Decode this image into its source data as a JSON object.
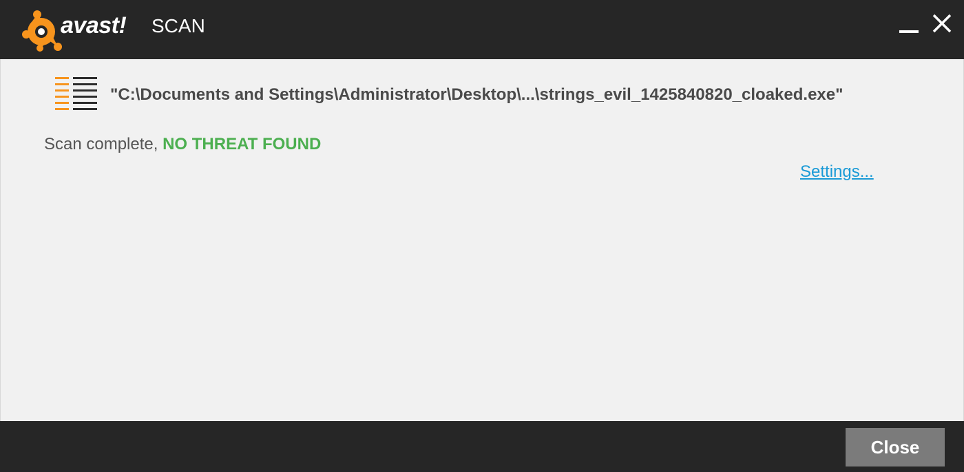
{
  "window": {
    "brand_name": "avast!",
    "title": "SCAN"
  },
  "icons": {
    "logo": "avast-logo-icon",
    "minimize": "minimize-icon",
    "close": "close-icon",
    "file": "file-list-icon"
  },
  "colors": {
    "titlebar": "#262626",
    "accent_orange": "#f7941d",
    "no_threat_green": "#4caf50",
    "link_blue": "#1a9ad6"
  },
  "scan": {
    "file_path": "\"C:\\Documents and Settings\\Administrator\\Desktop\\...\\strings_evil_1425840820_cloaked.exe\"",
    "status_prefix": "Scan complete, ",
    "status_result": "NO THREAT FOUND"
  },
  "links": {
    "settings": "Settings..."
  },
  "footer": {
    "close_label": "Close"
  }
}
